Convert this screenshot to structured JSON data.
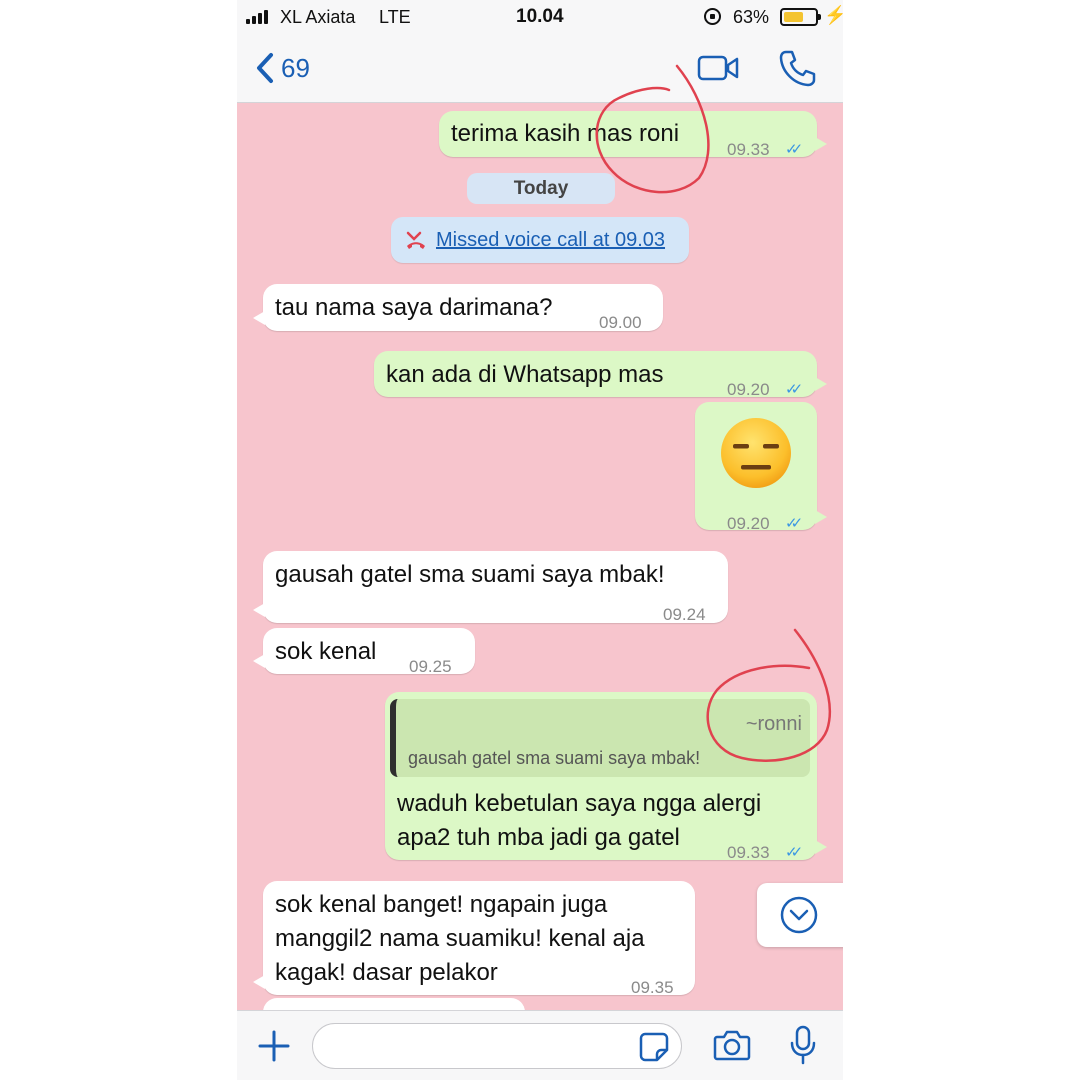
{
  "status_bar": {
    "carrier": "XL Axiata",
    "network": "LTE",
    "time": "10.04",
    "battery_percent": "63%",
    "battery_level": 0.63,
    "icons": [
      "signal-bars-icon",
      "orientation-lock-icon",
      "battery-icon",
      "charging-bolt-icon"
    ]
  },
  "nav": {
    "back_icon": "chevron-left-icon",
    "unread_count": "69",
    "actions": [
      "video-call-icon",
      "voice-call-icon"
    ]
  },
  "chat": {
    "date_separator": "Today",
    "missed_call": "Missed voice call at 09.03",
    "messages": [
      {
        "direction": "out",
        "text": "terima kasih mas roni",
        "time": "09.33",
        "read": true
      },
      {
        "direction": "in",
        "text": "tau nama saya darimana?",
        "time": "09.00"
      },
      {
        "direction": "out",
        "text": "kan ada di Whatsapp mas",
        "time": "09.20",
        "read": true
      },
      {
        "direction": "out",
        "text": "😑",
        "time": "09.20",
        "read": true
      },
      {
        "direction": "in",
        "text": "gausah gatel sma suami saya mbak!",
        "time": "09.24"
      },
      {
        "direction": "in",
        "text": "sok kenal",
        "time": "09.25"
      },
      {
        "direction": "out",
        "quote": {
          "author": "~ronni",
          "text": "gausah gatel sma suami saya mbak!"
        },
        "lines": [
          "waduh kebetulan saya ngga alergi",
          "apa2 tuh mba jadi ga gatel"
        ],
        "time": "09.33",
        "read": true
      },
      {
        "direction": "in",
        "lines": [
          "sok kenal banget! ngapain juga",
          "manggil2 nama suamiku! kenal aja",
          "kagak! dasar pelakor"
        ],
        "time": "09.35"
      }
    ],
    "annotation_color": "#e0424f"
  },
  "input_bar": {
    "placeholder": "",
    "icons": [
      "plus-icon",
      "sticker-icon",
      "camera-icon",
      "microphone-icon"
    ]
  },
  "colors": {
    "chat_background": "#f7c5cd",
    "outgoing_bubble": "#dcf8c6",
    "incoming_bubble": "#ffffff",
    "accent_blue": "#1a5fb4",
    "read_tick": "#3b97e3",
    "battery": "#f4c430"
  }
}
